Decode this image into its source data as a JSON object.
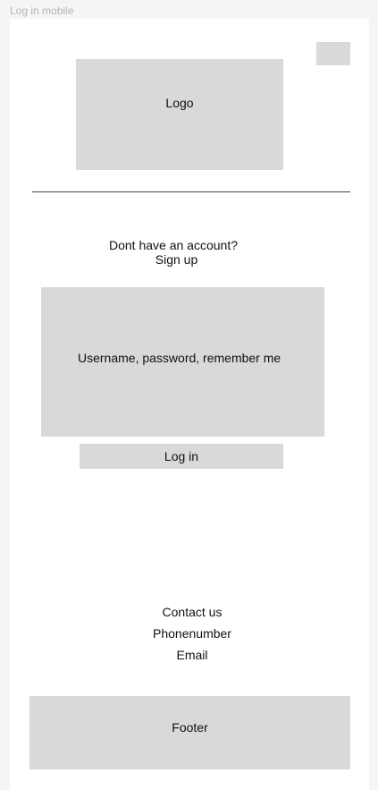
{
  "frame": {
    "title": "Log in mobile"
  },
  "header": {
    "logo_label": "Logo",
    "menu_icon": "menu-placeholder"
  },
  "auth": {
    "signup_prompt": "Dont have an account?",
    "signup_link": "Sign up",
    "form_placeholder": "Username, password, remember me",
    "login_button": "Log in"
  },
  "contact": {
    "title": "Contact us",
    "phone": "Phonenumber",
    "email": "Email"
  },
  "footer": {
    "label": "Footer"
  },
  "colors": {
    "placeholder_fill": "#d9d9d9",
    "canvas_background": "#f5f5f5",
    "frame_background": "#ffffff",
    "divider": "#444444"
  }
}
